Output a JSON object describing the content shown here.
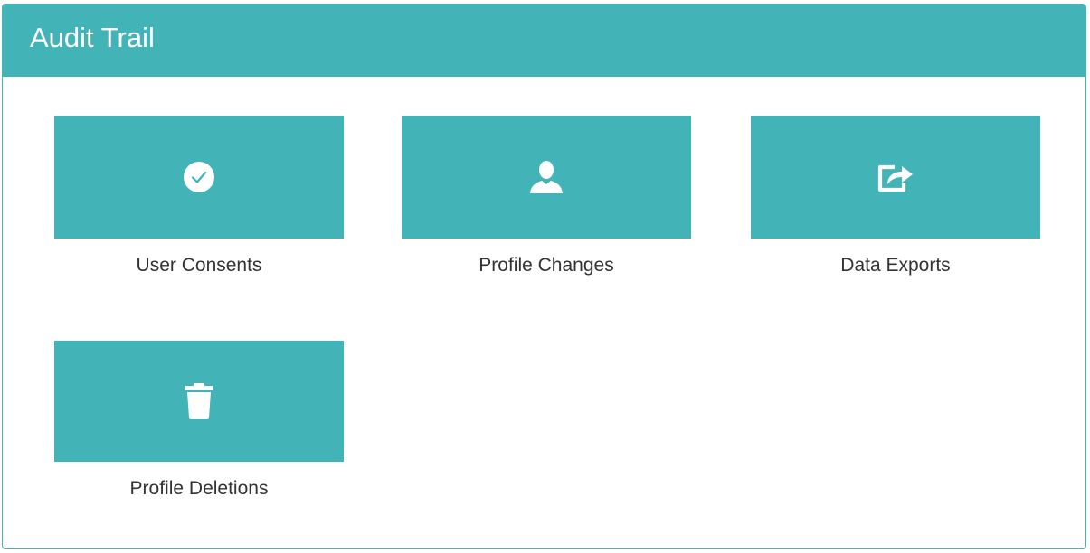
{
  "panel": {
    "title": "Audit Trail"
  },
  "tiles": [
    {
      "label": "User Consents",
      "icon": "check-circle-icon"
    },
    {
      "label": "Profile Changes",
      "icon": "user-icon"
    },
    {
      "label": "Data Exports",
      "icon": "share-icon"
    },
    {
      "label": "Profile Deletions",
      "icon": "trash-icon"
    }
  ],
  "colors": {
    "accent": "#42b4b8",
    "icon": "#ffffff",
    "label_text": "#333333"
  }
}
